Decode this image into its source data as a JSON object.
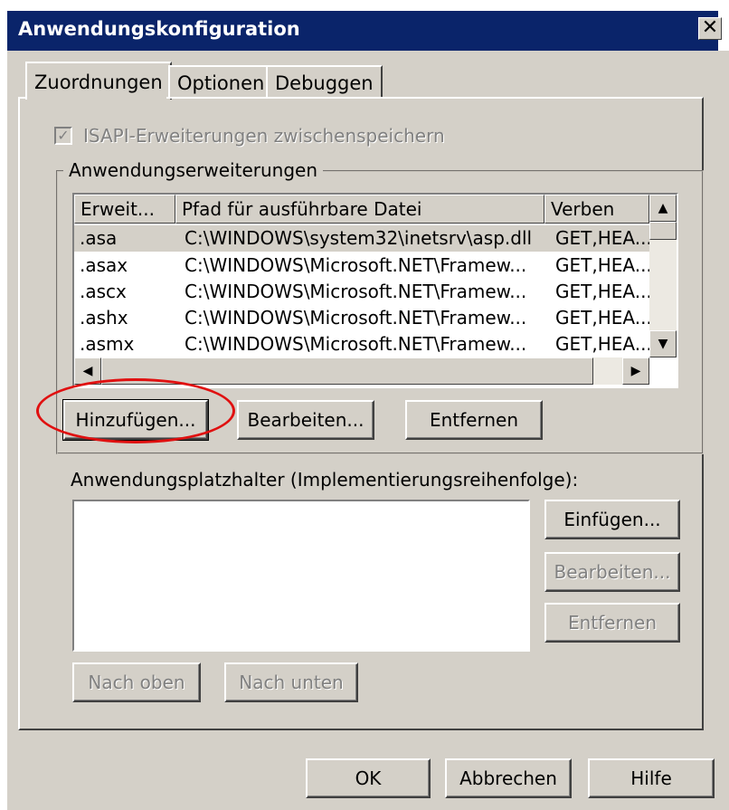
{
  "window": {
    "title": "Anwendungskonfiguration",
    "close_glyph": "✕"
  },
  "tabs": [
    {
      "label": "Zuordnungen",
      "active": true
    },
    {
      "label": "Optionen",
      "active": false
    },
    {
      "label": "Debuggen",
      "active": false
    }
  ],
  "isapi_cache": {
    "label": "ISAPI-Erweiterungen zwischenspeichern",
    "checked": true,
    "enabled": false
  },
  "extensions_group": {
    "legend": "Anwendungserweiterungen",
    "columns": [
      "Erweit...",
      "Pfad für ausführbare Datei",
      "Verben"
    ],
    "rows": [
      {
        "ext": ".asa",
        "path": "C:\\WINDOWS\\system32\\inetsrv\\asp.dll",
        "verbs": "GET,HEA...",
        "selected": true
      },
      {
        "ext": ".asax",
        "path": "C:\\WINDOWS\\Microsoft.NET\\Framew...",
        "verbs": "GET,HEA..."
      },
      {
        "ext": ".ascx",
        "path": "C:\\WINDOWS\\Microsoft.NET\\Framew...",
        "verbs": "GET,HEA..."
      },
      {
        "ext": ".ashx",
        "path": "C:\\WINDOWS\\Microsoft.NET\\Framew...",
        "verbs": "GET,HEA..."
      },
      {
        "ext": ".asmx",
        "path": "C:\\WINDOWS\\Microsoft.NET\\Framew...",
        "verbs": "GET,HEA..."
      }
    ],
    "buttons": {
      "add": "Hinzufügen...",
      "edit": "Bearbeiten...",
      "remove": "Entfernen"
    }
  },
  "placeholders": {
    "label": "Anwendungsplatzhalter (Implementierungsreihenfolge):",
    "buttons": {
      "insert": "Einfügen...",
      "edit": "Bearbeiten...",
      "remove": "Entfernen",
      "move_up": "Nach oben",
      "move_down": "Nach unten"
    }
  },
  "footer": {
    "ok": "OK",
    "cancel": "Abbrechen",
    "help": "Hilfe"
  },
  "icons": {
    "scroll_up": "▲",
    "scroll_down": "▼",
    "scroll_left": "◀",
    "scroll_right": "▶",
    "check": "✓"
  },
  "colors": {
    "titlebar": "#0a246a",
    "dialog": "#d4d0c8",
    "highlight_circle": "#e01010"
  }
}
